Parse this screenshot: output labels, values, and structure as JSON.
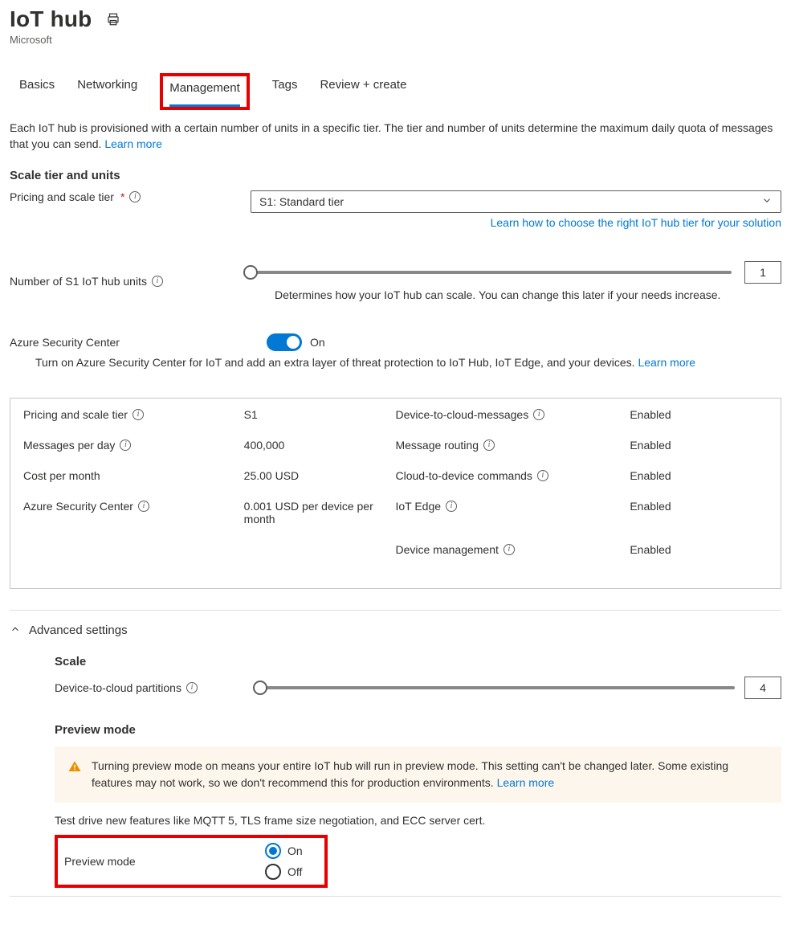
{
  "header": {
    "title": "IoT hub",
    "subtitle": "Microsoft"
  },
  "tabs": {
    "basics": "Basics",
    "networking": "Networking",
    "management": "Management",
    "tags": "Tags",
    "review": "Review + create"
  },
  "intro": {
    "text": "Each IoT hub is provisioned with a certain number of units in a specific tier. The tier and number of units determine the maximum daily quota of messages that you can send.",
    "learn": "Learn more"
  },
  "scale": {
    "heading": "Scale tier and units",
    "pricing_label": "Pricing and scale tier",
    "pricing_value": "S1: Standard tier",
    "tier_link": "Learn how to choose the right IoT hub tier for your solution",
    "units_label": "Number of S1 IoT hub units",
    "units_value": "1",
    "units_helper": "Determines how your IoT hub can scale. You can change this later if your needs increase."
  },
  "asc": {
    "label": "Azure Security Center",
    "state": "On",
    "desc": "Turn on Azure Security Center for IoT and add an extra layer of threat protection to IoT Hub, IoT Edge, and your devices.",
    "learn": "Learn more"
  },
  "summary": {
    "left": [
      {
        "label": "Pricing and scale tier",
        "info": true,
        "value": "S1"
      },
      {
        "label": "Messages per day",
        "info": true,
        "value": "400,000"
      },
      {
        "label": "Cost per month",
        "info": false,
        "value": "25.00 USD"
      },
      {
        "label": "Azure Security Center",
        "info": true,
        "value": "0.001 USD per device per month"
      }
    ],
    "right": [
      {
        "label": "Device-to-cloud-messages",
        "info": true,
        "value": "Enabled"
      },
      {
        "label": "Message routing",
        "info": true,
        "value": "Enabled"
      },
      {
        "label": "Cloud-to-device commands",
        "info": true,
        "value": "Enabled"
      },
      {
        "label": "IoT Edge",
        "info": true,
        "value": "Enabled"
      },
      {
        "label": "Device management",
        "info": true,
        "value": "Enabled"
      }
    ]
  },
  "advanced": {
    "heading": "Advanced settings",
    "scale_h": "Scale",
    "partitions_label": "Device-to-cloud partitions",
    "partitions_value": "4",
    "preview_h": "Preview mode",
    "warn": "Turning preview mode on means your entire IoT hub will run in preview mode. This setting can't be changed later. Some existing features may not work, so we don't recommend this for production environments.",
    "warn_learn": "Learn more",
    "test_drive": "Test drive new features like MQTT 5, TLS frame size negotiation, and ECC server cert.",
    "preview_label": "Preview mode",
    "opt_on": "On",
    "opt_off": "Off"
  }
}
